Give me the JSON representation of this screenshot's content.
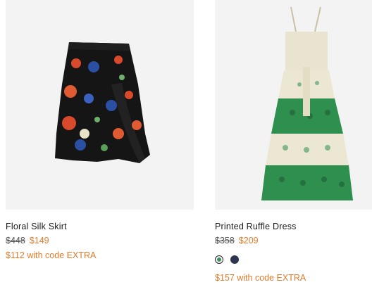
{
  "products": [
    {
      "name": "Floral Silk Skirt",
      "original_price": "$448",
      "sale_price": "$149",
      "promo_text": "$112 with code EXTRA",
      "image_alt": "floral-skirt-image"
    },
    {
      "name": "Printed Ruffle Dress",
      "original_price": "$358",
      "sale_price": "$209",
      "promo_text": "$157 with code EXTRA",
      "image_alt": "ruffle-dress-image",
      "swatches": [
        {
          "color": "#3f8f5e",
          "selected": true
        },
        {
          "color": "#2d3550",
          "selected": false
        }
      ]
    }
  ],
  "colors": {
    "sale": "#e07b2b",
    "image_bg": "#f3f3f3"
  }
}
